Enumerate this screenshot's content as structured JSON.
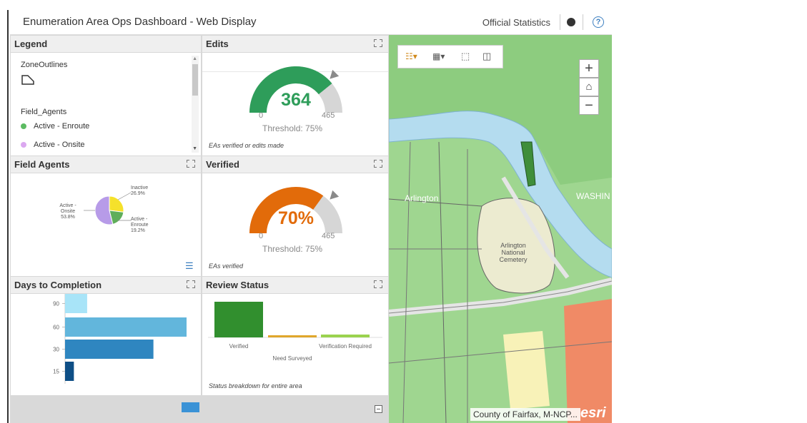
{
  "header": {
    "title": "Enumeration Area Ops Dashboard - Web Display",
    "org": "Official Statistics"
  },
  "legend": {
    "title": "Legend",
    "zone_title": "ZoneOutlines",
    "agents_title": "Field_Agents",
    "items": [
      {
        "label": "Active - Enroute",
        "color": "#5cbb62"
      },
      {
        "label": "Active - Onsite",
        "color": "#dba8f0"
      }
    ]
  },
  "edits": {
    "title": "Edits",
    "value": "364",
    "min": "0",
    "max": "465",
    "threshold": "Threshold: 75%",
    "caption": "EAs verified or edits made",
    "color": "#2e9d5a",
    "fraction": 0.783
  },
  "field_agents": {
    "title": "Field Agents"
  },
  "verified": {
    "title": "Verified",
    "value": "70%",
    "min": "0",
    "max": "465",
    "threshold": "Threshold: 75%",
    "caption": "EAs verified",
    "color": "#e26b0a",
    "fraction": 0.7
  },
  "days": {
    "title": "Days to Completion"
  },
  "review": {
    "title": "Review Status",
    "caption": "Status breakdown for entire area"
  },
  "map": {
    "labels": {
      "arlington": "Arlington",
      "washington": "WASHIN",
      "cemetery": "Arlington\nNational\nCemetery"
    },
    "attribution": "County of Fairfax, M-NCP...",
    "brand": "esri"
  },
  "chart_data": [
    {
      "type": "pie",
      "categories": [
        "Inactive",
        "Active - Enroute",
        "Active - Onsite"
      ],
      "values": [
        26.9,
        19.2,
        53.8
      ],
      "labels": [
        "26.9%",
        "19.2%",
        "53.8%"
      ],
      "colors": [
        "#f5e12b",
        "#5fae5a",
        "#b79be8"
      ]
    },
    {
      "type": "bar",
      "orientation": "horizontal",
      "categories": [
        "90",
        "60",
        "30",
        "15"
      ],
      "values": [
        20,
        110,
        80,
        8
      ],
      "colors": [
        "#a8e4f8",
        "#62b6dc",
        "#2f86c0",
        "#0e4f86"
      ]
    },
    {
      "type": "bar",
      "categories": [
        "Verified",
        "Need Surveyed",
        "Verification Required"
      ],
      "values": [
        100,
        4,
        8
      ],
      "colors": [
        "#318f2e",
        "#e0a72b",
        "#9ad24e"
      ]
    }
  ]
}
